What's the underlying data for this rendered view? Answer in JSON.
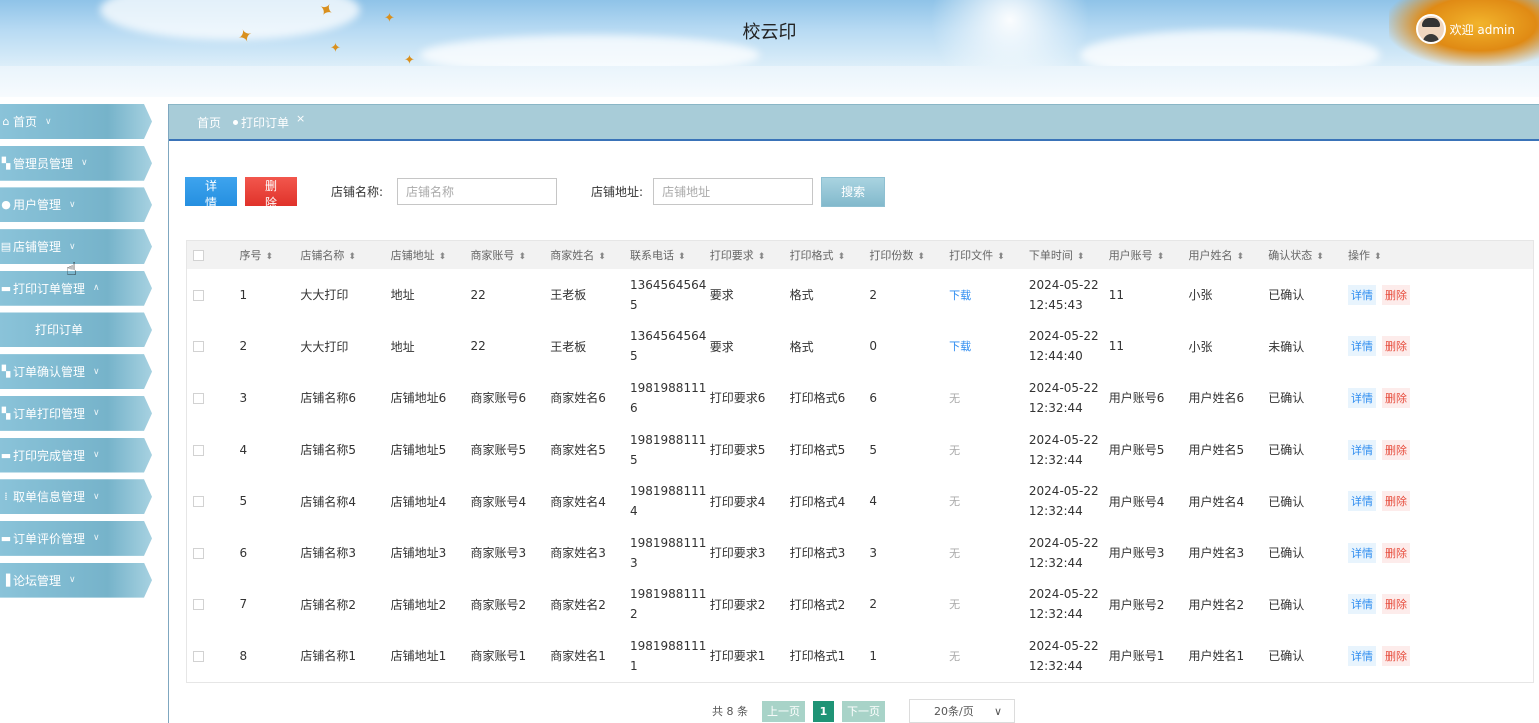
{
  "app": {
    "title": "校云印",
    "welcome": "欢迎 admin"
  },
  "sidebar": {
    "items": [
      {
        "label": "首页",
        "icon": "home-icon"
      },
      {
        "label": "管理员管理",
        "icon": "grid-icon"
      },
      {
        "label": "用户管理",
        "icon": "user-icon"
      },
      {
        "label": "店铺管理",
        "icon": "shop-icon"
      },
      {
        "label": "打印订单管理",
        "icon": "order-icon"
      },
      {
        "label": "订单确认管理",
        "icon": "grid-icon"
      },
      {
        "label": "订单打印管理",
        "icon": "grid-icon"
      },
      {
        "label": "打印完成管理",
        "icon": "order-icon"
      },
      {
        "label": "取单信息管理",
        "icon": "grid9-icon"
      },
      {
        "label": "订单评价管理",
        "icon": "order-icon"
      },
      {
        "label": "论坛管理",
        "icon": "forum-icon"
      }
    ],
    "sub_item": "打印订单"
  },
  "tabs": {
    "home": "首页",
    "active": "打印订单",
    "close": "×"
  },
  "toolbar": {
    "detail": "详情",
    "delete": "删除",
    "shop_name_label": "店铺名称:",
    "shop_name_placeholder": "店铺名称",
    "shop_addr_label": "店铺地址:",
    "shop_addr_placeholder": "店铺地址",
    "search": "搜索"
  },
  "table": {
    "headers": [
      "序号",
      "店铺名称",
      "店铺地址",
      "商家账号",
      "商家姓名",
      "联系电话",
      "打印要求",
      "打印格式",
      "打印份数",
      "打印文件",
      "下单时间",
      "用户账号",
      "用户姓名",
      "确认状态",
      "操作"
    ],
    "rows": [
      {
        "no": "1",
        "shop": "大大打印",
        "addr": "地址",
        "acct": "22",
        "merchant": "王老板",
        "phone": "13645645645",
        "req": "要求",
        "fmt": "格式",
        "copies": "2",
        "file": "下载",
        "file_link": true,
        "time": "2024-05-22 12:45:43",
        "user_acct": "11",
        "user_name": "小张",
        "status": "已确认"
      },
      {
        "no": "2",
        "shop": "大大打印",
        "addr": "地址",
        "acct": "22",
        "merchant": "王老板",
        "phone": "13645645645",
        "req": "要求",
        "fmt": "格式",
        "copies": "0",
        "file": "下载",
        "file_link": true,
        "time": "2024-05-22 12:44:40",
        "user_acct": "11",
        "user_name": "小张",
        "status": "未确认"
      },
      {
        "no": "3",
        "shop": "店铺名称6",
        "addr": "店铺地址6",
        "acct": "商家账号6",
        "merchant": "商家姓名6",
        "phone": "19819881116",
        "req": "打印要求6",
        "fmt": "打印格式6",
        "copies": "6",
        "file": "无",
        "file_link": false,
        "time": "2024-05-22 12:32:44",
        "user_acct": "用户账号6",
        "user_name": "用户姓名6",
        "status": "已确认"
      },
      {
        "no": "4",
        "shop": "店铺名称5",
        "addr": "店铺地址5",
        "acct": "商家账号5",
        "merchant": "商家姓名5",
        "phone": "19819881115",
        "req": "打印要求5",
        "fmt": "打印格式5",
        "copies": "5",
        "file": "无",
        "file_link": false,
        "time": "2024-05-22 12:32:44",
        "user_acct": "用户账号5",
        "user_name": "用户姓名5",
        "status": "已确认"
      },
      {
        "no": "5",
        "shop": "店铺名称4",
        "addr": "店铺地址4",
        "acct": "商家账号4",
        "merchant": "商家姓名4",
        "phone": "19819881114",
        "req": "打印要求4",
        "fmt": "打印格式4",
        "copies": "4",
        "file": "无",
        "file_link": false,
        "time": "2024-05-22 12:32:44",
        "user_acct": "用户账号4",
        "user_name": "用户姓名4",
        "status": "已确认"
      },
      {
        "no": "6",
        "shop": "店铺名称3",
        "addr": "店铺地址3",
        "acct": "商家账号3",
        "merchant": "商家姓名3",
        "phone": "19819881113",
        "req": "打印要求3",
        "fmt": "打印格式3",
        "copies": "3",
        "file": "无",
        "file_link": false,
        "time": "2024-05-22 12:32:44",
        "user_acct": "用户账号3",
        "user_name": "用户姓名3",
        "status": "已确认"
      },
      {
        "no": "7",
        "shop": "店铺名称2",
        "addr": "店铺地址2",
        "acct": "商家账号2",
        "merchant": "商家姓名2",
        "phone": "19819881112",
        "req": "打印要求2",
        "fmt": "打印格式2",
        "copies": "2",
        "file": "无",
        "file_link": false,
        "time": "2024-05-22 12:32:44",
        "user_acct": "用户账号2",
        "user_name": "用户姓名2",
        "status": "已确认"
      },
      {
        "no": "8",
        "shop": "店铺名称1",
        "addr": "店铺地址1",
        "acct": "商家账号1",
        "merchant": "商家姓名1",
        "phone": "19819881111",
        "req": "打印要求1",
        "fmt": "打印格式1",
        "copies": "1",
        "file": "无",
        "file_link": false,
        "time": "2024-05-22 12:32:44",
        "user_acct": "用户账号1",
        "user_name": "用户姓名1",
        "status": "已确认"
      }
    ],
    "op_detail": "详情",
    "op_delete": "删除"
  },
  "pager": {
    "total": "共 8 条",
    "prev": "上一页",
    "current": "1",
    "next": "下一页",
    "size": "20条/页"
  },
  "colors": {
    "accent_blue": "#2d8cf0",
    "delete_red": "#e0322a",
    "pager_active": "#1f9476",
    "tab_bar": "#a8ccd8"
  }
}
